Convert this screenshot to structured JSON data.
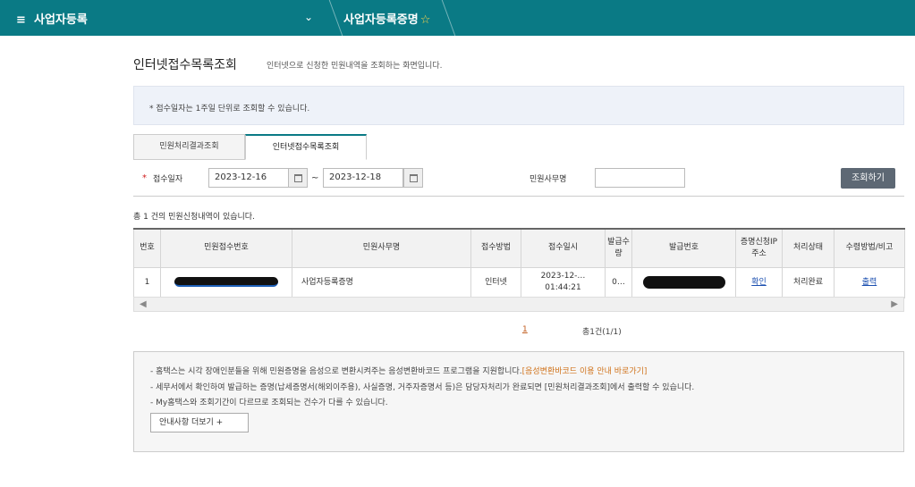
{
  "topbar": {
    "menu_label": "사업자등록",
    "menu_icon": "hamburger-icon",
    "crumb": "사업자등록증명",
    "bg": "#0a7a85"
  },
  "page": {
    "title": "인터넷접수목록조회",
    "desc": "인터넷으로 신청한 민원내역을 조회하는 화면입니다."
  },
  "notice": "* 접수일자는 1주일 단위로 조회할 수 있습니다.",
  "tabs": [
    "민원처리결과조회",
    "인터넷접수목록조회"
  ],
  "search": {
    "date_label": "접수일자",
    "date_from": "2023-12-16",
    "tilde": "~",
    "date_to": "2023-12-18",
    "name_label": "민원사무명",
    "button": "조회하기"
  },
  "result_count": "총 1 건의 민원신청내역이 있습니다.",
  "table": {
    "headers": {
      "no": "번호",
      "receipt_no": "민원접수번호",
      "name": "민원사무명",
      "method": "접수방법",
      "date": "접수일시",
      "qty": "발급수량",
      "issue_no": "발급번호",
      "ip": "증명신청IP주소",
      "status": "처리상태",
      "receive": "수령방법/비고"
    },
    "rows": [
      {
        "no": "1",
        "name": "사업자등록증명",
        "method": "인터넷",
        "date1": "2023-12-…",
        "date2": "01:44:21",
        "qty": "0…",
        "ip": "확인",
        "status": "처리완료",
        "receive": "출력"
      }
    ]
  },
  "pagination": {
    "current": "1",
    "total": "총1건(1/1)"
  },
  "guide": {
    "line1": "- 홈택스는 시각 장애인분들을 위해 민원증명을 음성으로 변환시켜주는 음성변환바코드 프로그램을 지원합니다.",
    "line1_link": "[음성변환바코드 이용 안내 바로가기]",
    "line2": "- 세무서에서 확인하여 발급하는 증명(납세증명서(해외이주용), 사실증명, 거주자증명서 등)은 담당자처리가 완료되면 [민원처리결과조회]에서 출력할 수 있습니다.",
    "line3": "- My홈택스와 조회기간이 다르므로 조회되는 건수가 다를 수 있습니다.",
    "more_button": "안내사항 더보기 +"
  }
}
